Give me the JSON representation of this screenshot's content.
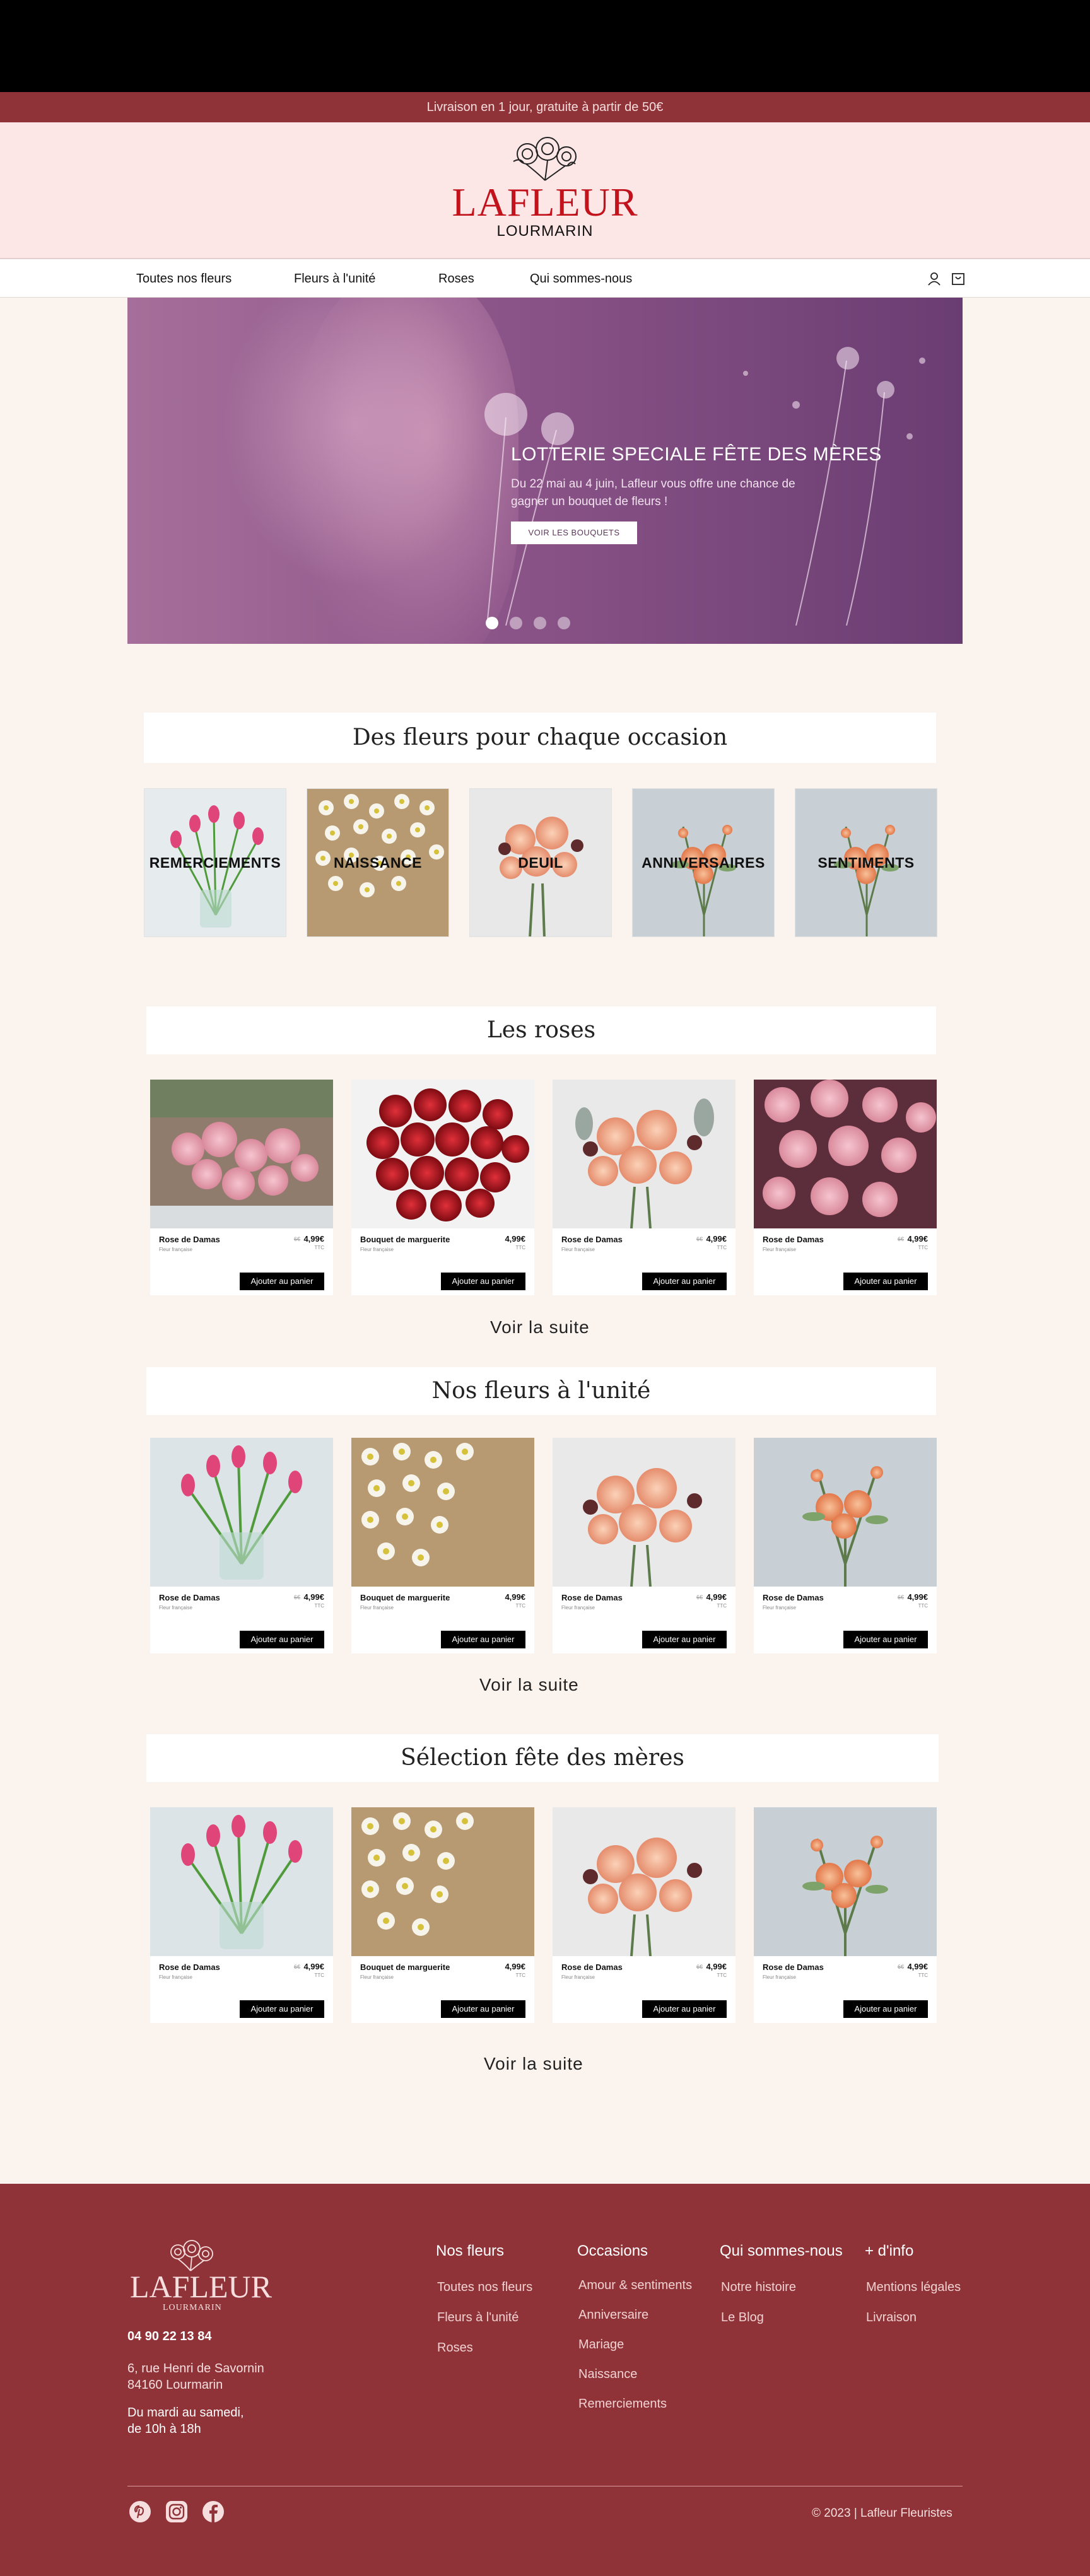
{
  "promo": "Livraison en 1 jour, gratuite à partir de 50€",
  "brand": {
    "name": "LAFLEUR",
    "town": "LOURMARIN"
  },
  "nav": {
    "items": [
      "Toutes nos fleurs",
      "Fleurs à l'unité",
      "Roses",
      "Qui sommes-nous"
    ],
    "icons": [
      "user-icon",
      "cart-icon"
    ]
  },
  "hero": {
    "title": "LOTTERIE SPECIALE FÊTE DES MÈRES",
    "text": "Du 22 mai au 4 juin, Lafleur vous offre une chance de gagner un bouquet de fleurs !",
    "button": "VOIR LES BOUQUETS",
    "slides": 4,
    "active_slide": 1
  },
  "occasions": {
    "title": "Des fleurs pour chaque occasion",
    "items": [
      "REMERCIEMENTS",
      "NAISSANCE",
      "DEUIL",
      "ANNIVERSAIRES",
      "SENTIMENTS"
    ]
  },
  "roses": {
    "title": "Les roses",
    "more": "Voir la suite",
    "products": [
      {
        "name": "Rose de Damas",
        "sub": "Fleur française",
        "old": "6€",
        "price": "4,99€",
        "unit": "TTC",
        "button": "Ajouter au panier"
      },
      {
        "name": "Bouquet de marguerite",
        "sub": "Fleur française",
        "old": "",
        "price": "4,99€",
        "unit": "TTC",
        "button": "Ajouter au panier"
      },
      {
        "name": "Rose de Damas",
        "sub": "Fleur française",
        "old": "6€",
        "price": "4,99€",
        "unit": "TTC",
        "button": "Ajouter au panier"
      },
      {
        "name": "Rose de Damas",
        "sub": "Fleur française",
        "old": "6€",
        "price": "4,99€",
        "unit": "TTC",
        "button": "Ajouter au panier"
      }
    ]
  },
  "unit_flowers": {
    "title": "Nos fleurs à l'unité",
    "more": "Voir la suite",
    "products": [
      {
        "name": "Rose de Damas",
        "sub": "Fleur française",
        "old": "6€",
        "price": "4,99€",
        "unit": "TTC",
        "button": "Ajouter au panier"
      },
      {
        "name": "Bouquet de marguerite",
        "sub": "Fleur française",
        "old": "",
        "price": "4,99€",
        "unit": "TTC",
        "button": "Ajouter au panier"
      },
      {
        "name": "Rose de Damas",
        "sub": "Fleur française",
        "old": "6€",
        "price": "4,99€",
        "unit": "TTC",
        "button": "Ajouter au panier"
      },
      {
        "name": "Rose de Damas",
        "sub": "Fleur française",
        "old": "6€",
        "price": "4,99€",
        "unit": "TTC",
        "button": "Ajouter au panier"
      }
    ]
  },
  "mothers_day": {
    "title": "Sélection fête des mères",
    "more": "Voir la suite",
    "products": [
      {
        "name": "Rose de Damas",
        "sub": "Fleur française",
        "old": "6€",
        "price": "4,99€",
        "unit": "TTC",
        "button": "Ajouter au panier"
      },
      {
        "name": "Bouquet de marguerite",
        "sub": "Fleur française",
        "old": "",
        "price": "4,99€",
        "unit": "TTC",
        "button": "Ajouter au panier"
      },
      {
        "name": "Rose de Damas",
        "sub": "Fleur française",
        "old": "6€",
        "price": "4,99€",
        "unit": "TTC",
        "button": "Ajouter au panier"
      },
      {
        "name": "Rose de Damas",
        "sub": "Fleur française",
        "old": "6€",
        "price": "4,99€",
        "unit": "TTC",
        "button": "Ajouter au panier"
      }
    ]
  },
  "footer": {
    "phone": "04 90 22 13 84",
    "address1": "6, rue Henri de Savornin",
    "address2": "84160 Lourmarin",
    "hours1": "Du mardi au samedi,",
    "hours2": "de 10h à 18h",
    "columns": [
      {
        "title": "Nos fleurs",
        "links": [
          "Toutes nos fleurs",
          "Fleurs à l'unité",
          "Roses"
        ]
      },
      {
        "title": "Occasions",
        "links": [
          "Amour & sentiments",
          "Anniversaire",
          "Mariage",
          "Naissance",
          "Remerciements"
        ]
      },
      {
        "title": "Qui sommes-nous",
        "links": [
          "Notre histoire",
          "Le Blog"
        ]
      },
      {
        "title": "+ d'info",
        "links": [
          "Mentions légales",
          "Livraison"
        ]
      }
    ],
    "social": [
      "pinterest-icon",
      "instagram-icon",
      "facebook-icon"
    ],
    "copyright": "© 2023 | Lafleur Fleuristes"
  },
  "colors": {
    "burgundy": "#8f3338",
    "pink_band": "#fde6e6",
    "page_bg": "#fbf3ee",
    "logo_red": "#c2131d"
  }
}
